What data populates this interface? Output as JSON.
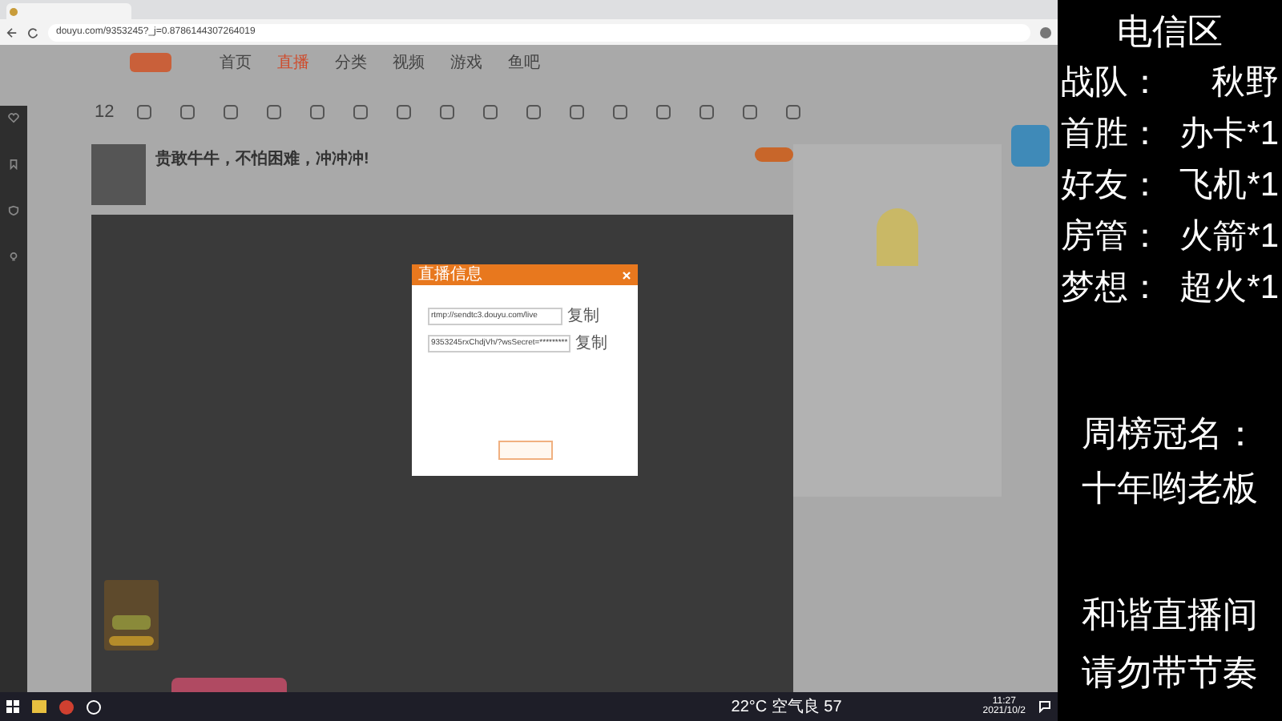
{
  "browser": {
    "url": "douyu.com/9353245?_j=0.8786144307264019"
  },
  "nav": [
    {
      "label": "首页",
      "selected": false
    },
    {
      "label": "直播",
      "selected": true
    },
    {
      "label": "分类",
      "selected": false
    },
    {
      "label": "视频",
      "selected": false
    },
    {
      "label": "游戏",
      "selected": false
    },
    {
      "label": "鱼吧",
      "selected": false
    }
  ],
  "count": "12",
  "stream_title": "贵敢牛牛，不怕困难，冲冲冲!",
  "dialog": {
    "title": "直播信息",
    "fields": [
      {
        "value": "rtmp://sendtc3.douyu.com/live",
        "action": "复制"
      },
      {
        "value": "9353245rxChdjVh/?wsSecret=*********",
        "action": "复制"
      }
    ]
  },
  "taskbar": {
    "weather": "22°C 空气良 57",
    "time": "11:27",
    "date": "2021/10/2"
  },
  "overlay": {
    "heading": "电信区",
    "rows": [
      {
        "label": "战队：",
        "value": "秋野"
      },
      {
        "label": "首胜：",
        "value": "办卡*1"
      },
      {
        "label": "好友：",
        "value": "飞机*1"
      },
      {
        "label": "房管：",
        "value": "火箭*1"
      },
      {
        "label": "梦想：",
        "value": "超火*1"
      }
    ],
    "sponsor_label": "周榜冠名：",
    "sponsor": "十年哟老板",
    "notice": [
      "和谐直播间",
      "请勿带节奏"
    ]
  }
}
